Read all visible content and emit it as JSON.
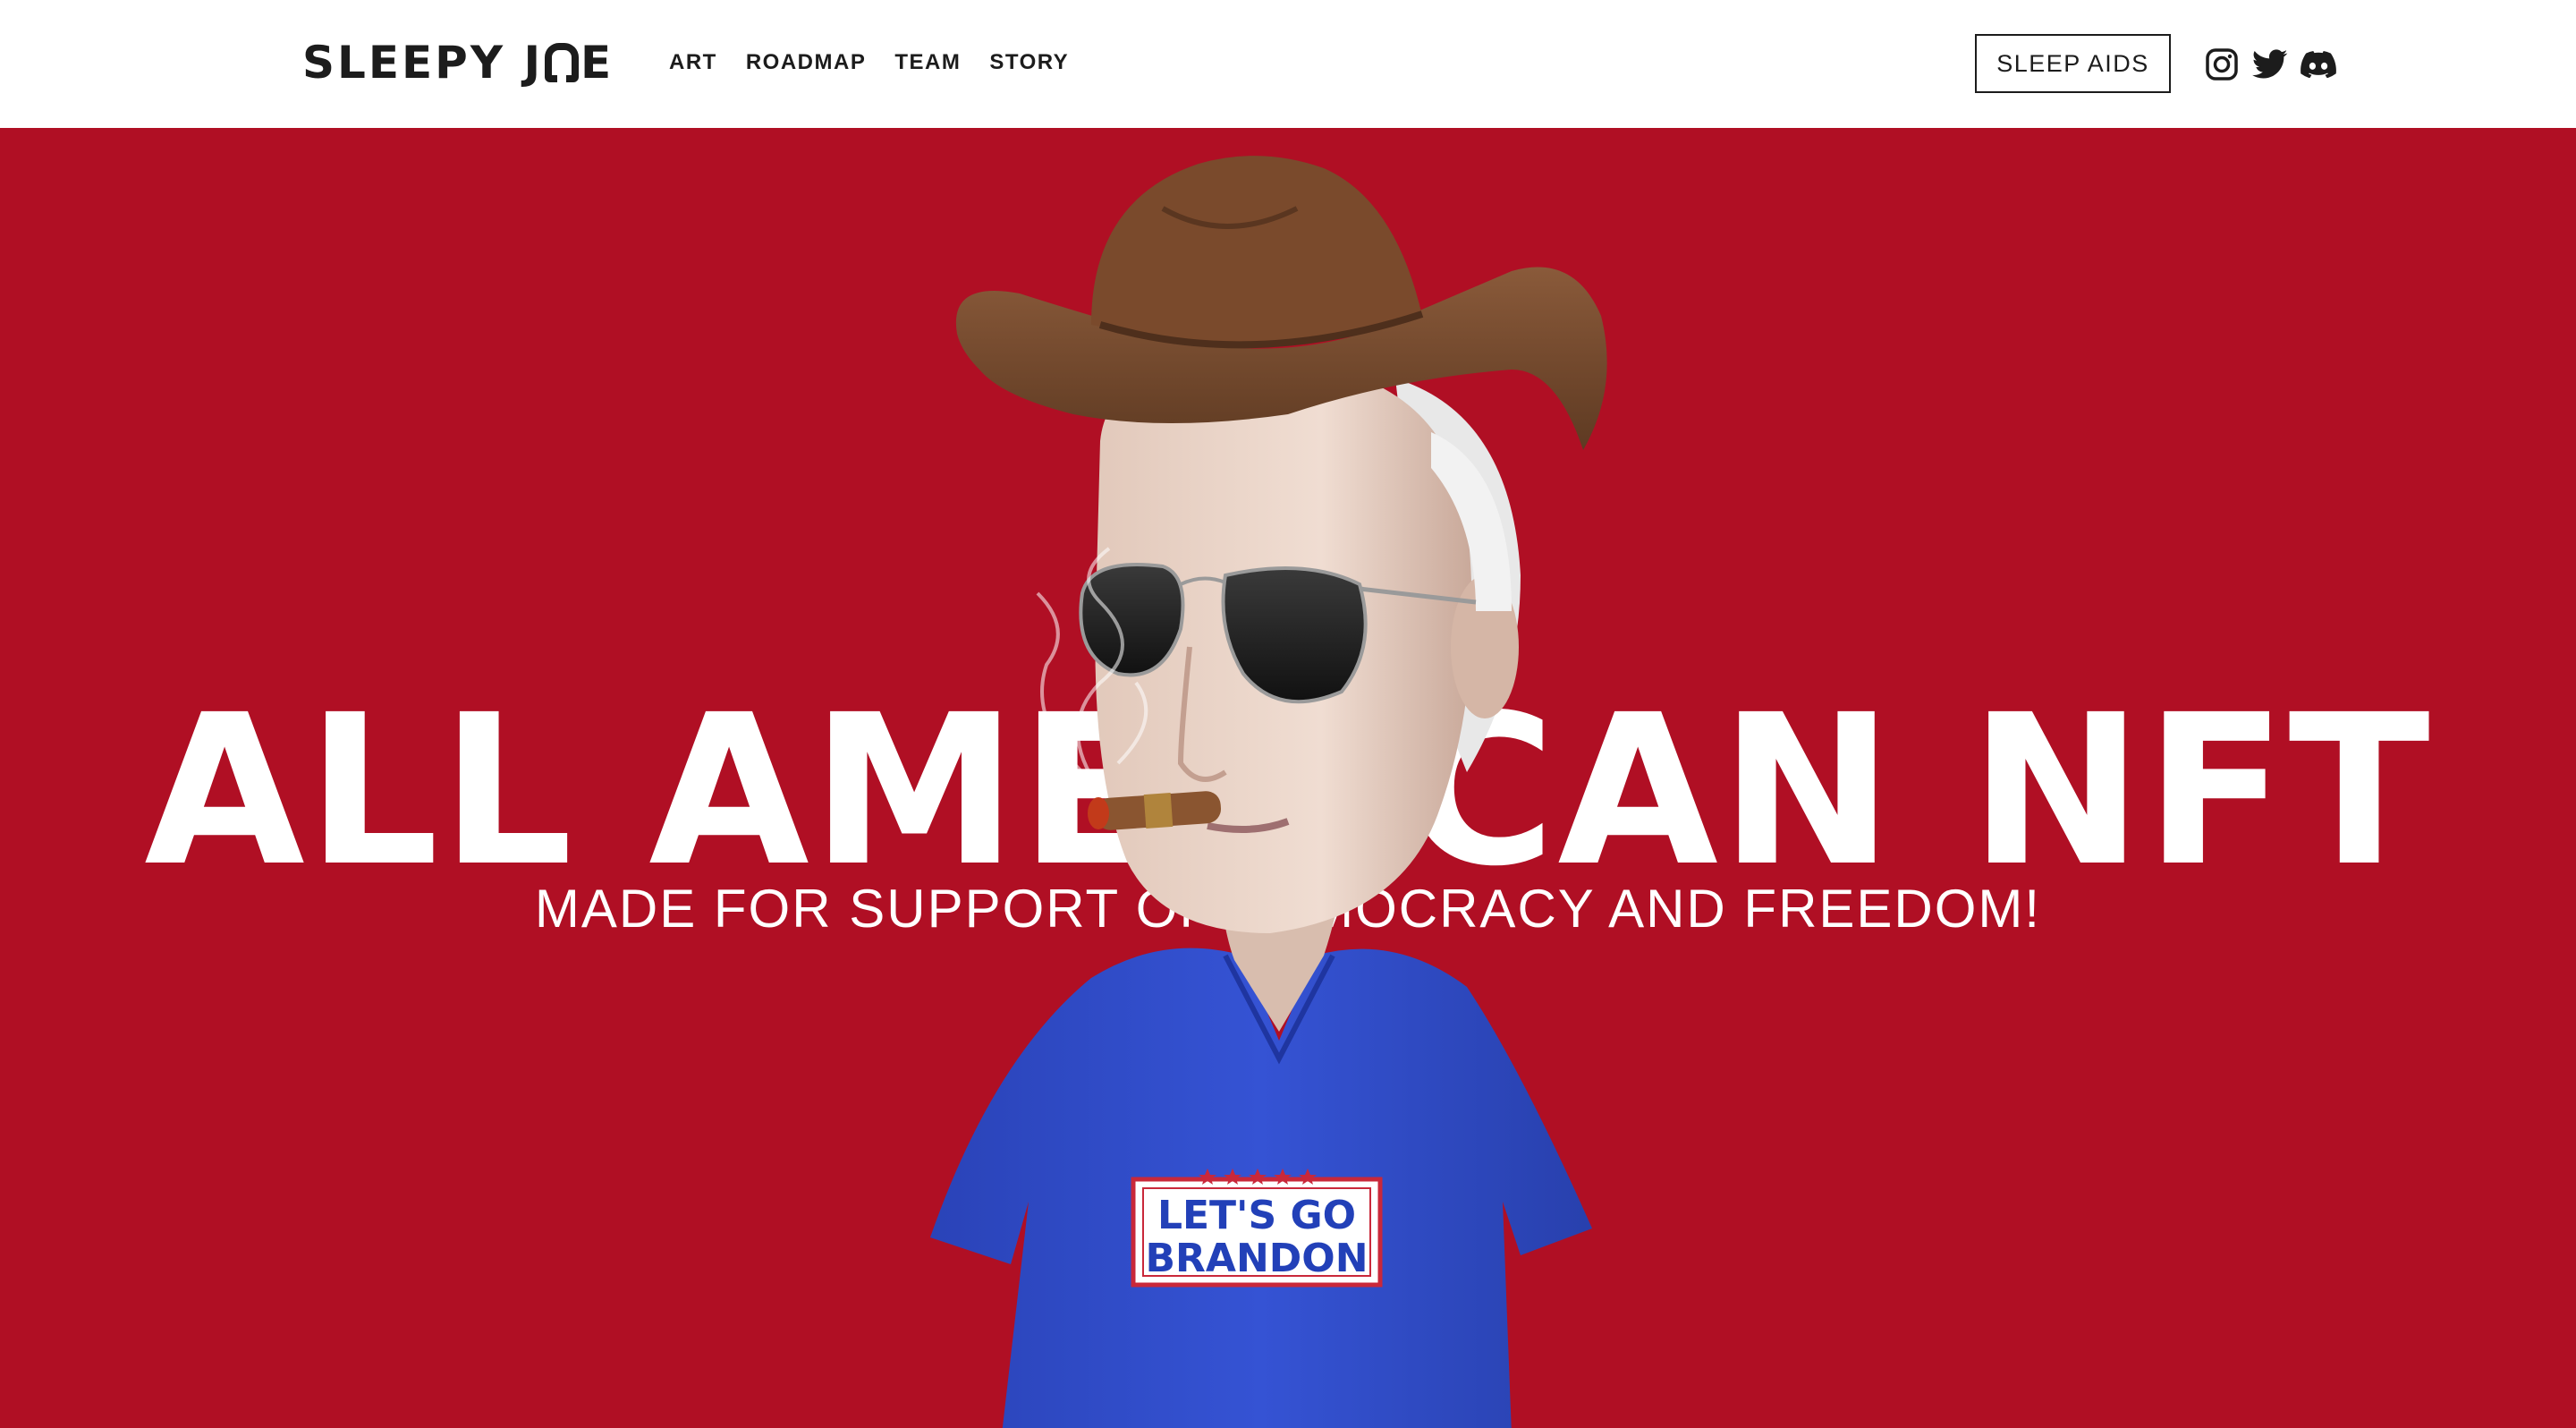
{
  "header": {
    "logo_text_left": "SLEEPY J",
    "logo_text_right": "E",
    "nav": [
      {
        "label": "ART"
      },
      {
        "label": "ROADMAP"
      },
      {
        "label": "TEAM"
      },
      {
        "label": "STORY"
      }
    ],
    "cta_label": "SLEEP AIDS",
    "socials": [
      {
        "icon": "instagram-icon"
      },
      {
        "icon": "twitter-icon"
      },
      {
        "icon": "discord-icon"
      }
    ]
  },
  "hero": {
    "title": "ALL AMERICAN NFT",
    "subtitle": "MADE FOR SUPPORT OF DEMOCRACY AND FREEDOM!",
    "shirt_text": "LET'S GO BRANDON"
  },
  "colors": {
    "hero_background": "#b00f24",
    "text_dark": "#1c1c1c",
    "shirt_blue": "#2d4bc4",
    "hat_brown": "#7a4a2c"
  }
}
